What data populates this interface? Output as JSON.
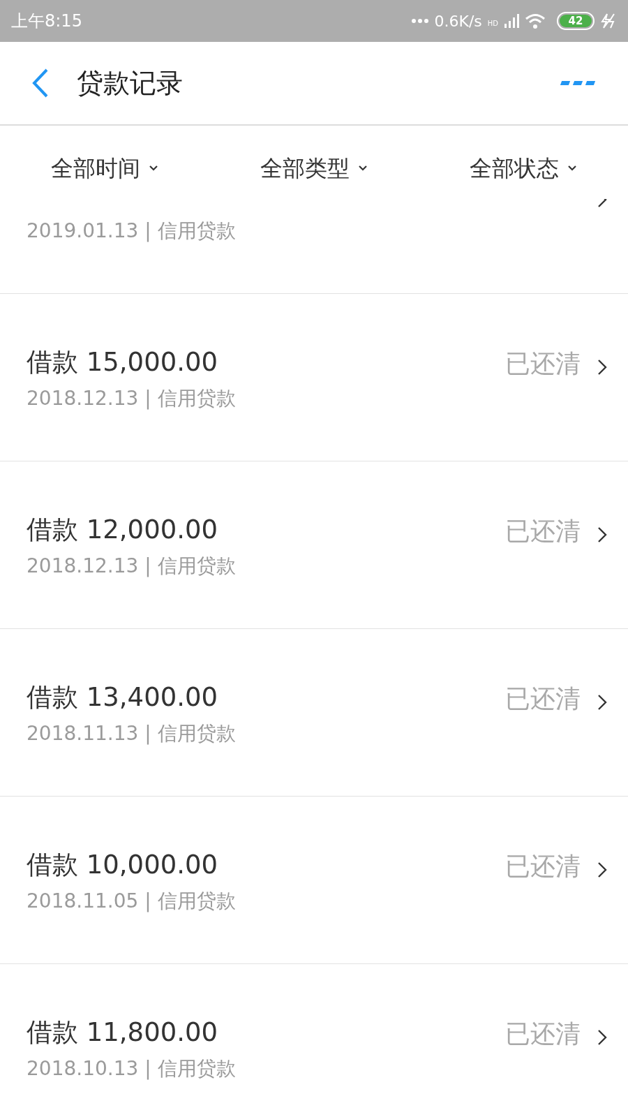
{
  "status_bar": {
    "time": "上午8:15",
    "speed": "0.6K/s",
    "network": "HD",
    "battery": "42"
  },
  "header": {
    "title": "贷款记录"
  },
  "filters": [
    {
      "label": "全部时间"
    },
    {
      "label": "全部类型"
    },
    {
      "label": "全部状态"
    }
  ],
  "loans": [
    {
      "date": "2019.01.13 | 信用贷款"
    },
    {
      "title": "借款 15,000.00",
      "date": "2018.12.13 | 信用贷款",
      "status": "已还清"
    },
    {
      "title": "借款 12,000.00",
      "date": "2018.12.13 | 信用贷款",
      "status": "已还清"
    },
    {
      "title": "借款 13,400.00",
      "date": "2018.11.13 | 信用贷款",
      "status": "已还清"
    },
    {
      "title": "借款 10,000.00",
      "date": "2018.11.05 | 信用贷款",
      "status": "已还清"
    },
    {
      "title": "借款 11,800.00",
      "date": "2018.10.13 | 信用贷款",
      "status": "已还清"
    }
  ]
}
